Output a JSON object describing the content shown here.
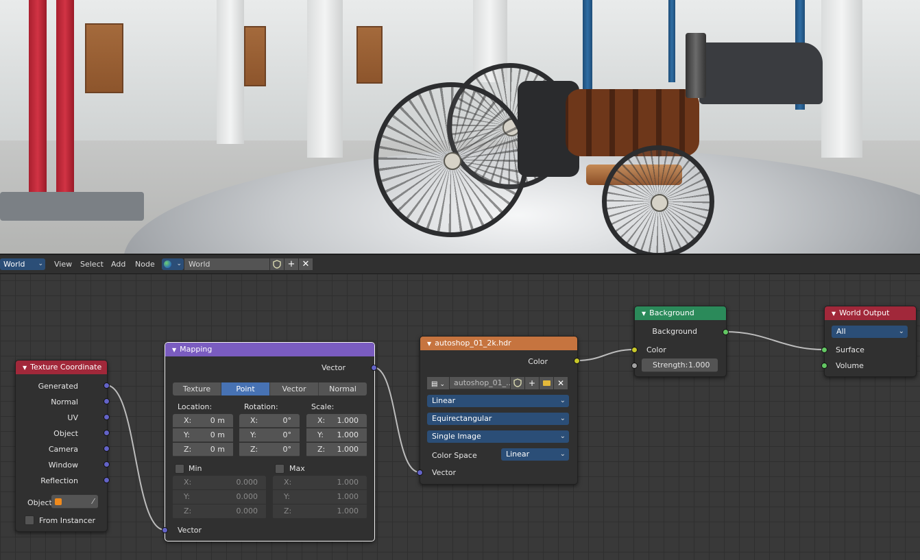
{
  "header": {
    "editor_type": "World",
    "menus": [
      "View",
      "Select",
      "Add",
      "Node"
    ],
    "world_name": "World"
  },
  "nodes": {
    "texture_coordinate": {
      "title": "Texture Coordinate",
      "color": "#a1283a",
      "outputs": [
        "Generated",
        "Normal",
        "UV",
        "Object",
        "Camera",
        "Window",
        "Reflection"
      ],
      "object_label": "Object:",
      "from_instancer": "From Instancer"
    },
    "mapping": {
      "title": "Mapping",
      "color": "#7a5cc0",
      "output": "Vector",
      "types": [
        "Texture",
        "Point",
        "Vector",
        "Normal"
      ],
      "active_type": "Point",
      "location": {
        "label": "Location:",
        "x": "0 m",
        "y": "0 m",
        "z": "0 m"
      },
      "rotation": {
        "label": "Rotation:",
        "x": "0°",
        "y": "0°",
        "z": "0°"
      },
      "scale": {
        "label": "Scale:",
        "x": "1.000",
        "y": "1.000",
        "z": "1.000"
      },
      "axis": {
        "x": "X:",
        "y": "Y:",
        "z": "Z:"
      },
      "min": {
        "label": "Min",
        "x": "0.000",
        "y": "0.000",
        "z": "0.000"
      },
      "max": {
        "label": "Max",
        "x": "1.000",
        "y": "1.000",
        "z": "1.000"
      },
      "input": "Vector"
    },
    "env_texture": {
      "title": "autoshop_01_2k.hdr",
      "color": "#c6743f",
      "output": "Color",
      "image_name": "autoshop_01_...",
      "interpolation": "Linear",
      "projection": "Equirectangular",
      "source": "Single Image",
      "color_space_label": "Color Space",
      "color_space": "Linear",
      "input": "Vector"
    },
    "background": {
      "title": "Background",
      "color": "#2b8a5a",
      "output": "Background",
      "color_input": "Color",
      "strength_label": "Strength:",
      "strength": "1.000"
    },
    "world_output": {
      "title": "World Output",
      "color": "#a1283a",
      "target": "All",
      "surface": "Surface",
      "volume": "Volume"
    }
  },
  "icons": [
    "world-icon",
    "shield-icon",
    "plus-icon",
    "close-icon",
    "image-icon",
    "folder-icon",
    "eyedropper-icon",
    "cube-icon"
  ]
}
